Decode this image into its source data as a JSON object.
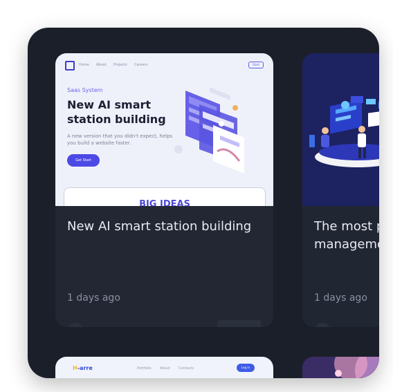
{
  "cards": [
    {
      "preview": {
        "nav_links": [
          "Home",
          "About",
          "Projects",
          "Careers"
        ],
        "start_label": "Start",
        "kicker": "Saas System",
        "headline": "New AI smart station building",
        "subtext": "A new version that you didn't expect, helps you build a website faster.",
        "cta_label": "Get Start",
        "banner_text": "BIG IDEAS"
      },
      "title": "New AI smart station building",
      "date": "1 days ago"
    },
    {
      "title": "The most popular management",
      "date": "1 days ago"
    }
  ],
  "bottom_cards": [
    {
      "preview": {
        "logo_prefix": "H",
        "logo_rest": "-arre",
        "nav_links": [
          "Portfolio",
          "About",
          "Contacts"
        ],
        "button_label": "Log in"
      }
    },
    {}
  ],
  "colors": {
    "frame_bg": "#1b1f2a",
    "card_bg": "#222733",
    "accent": "#4d49e6",
    "title_text": "#e9ebf2",
    "meta_text": "#8b90a3"
  }
}
